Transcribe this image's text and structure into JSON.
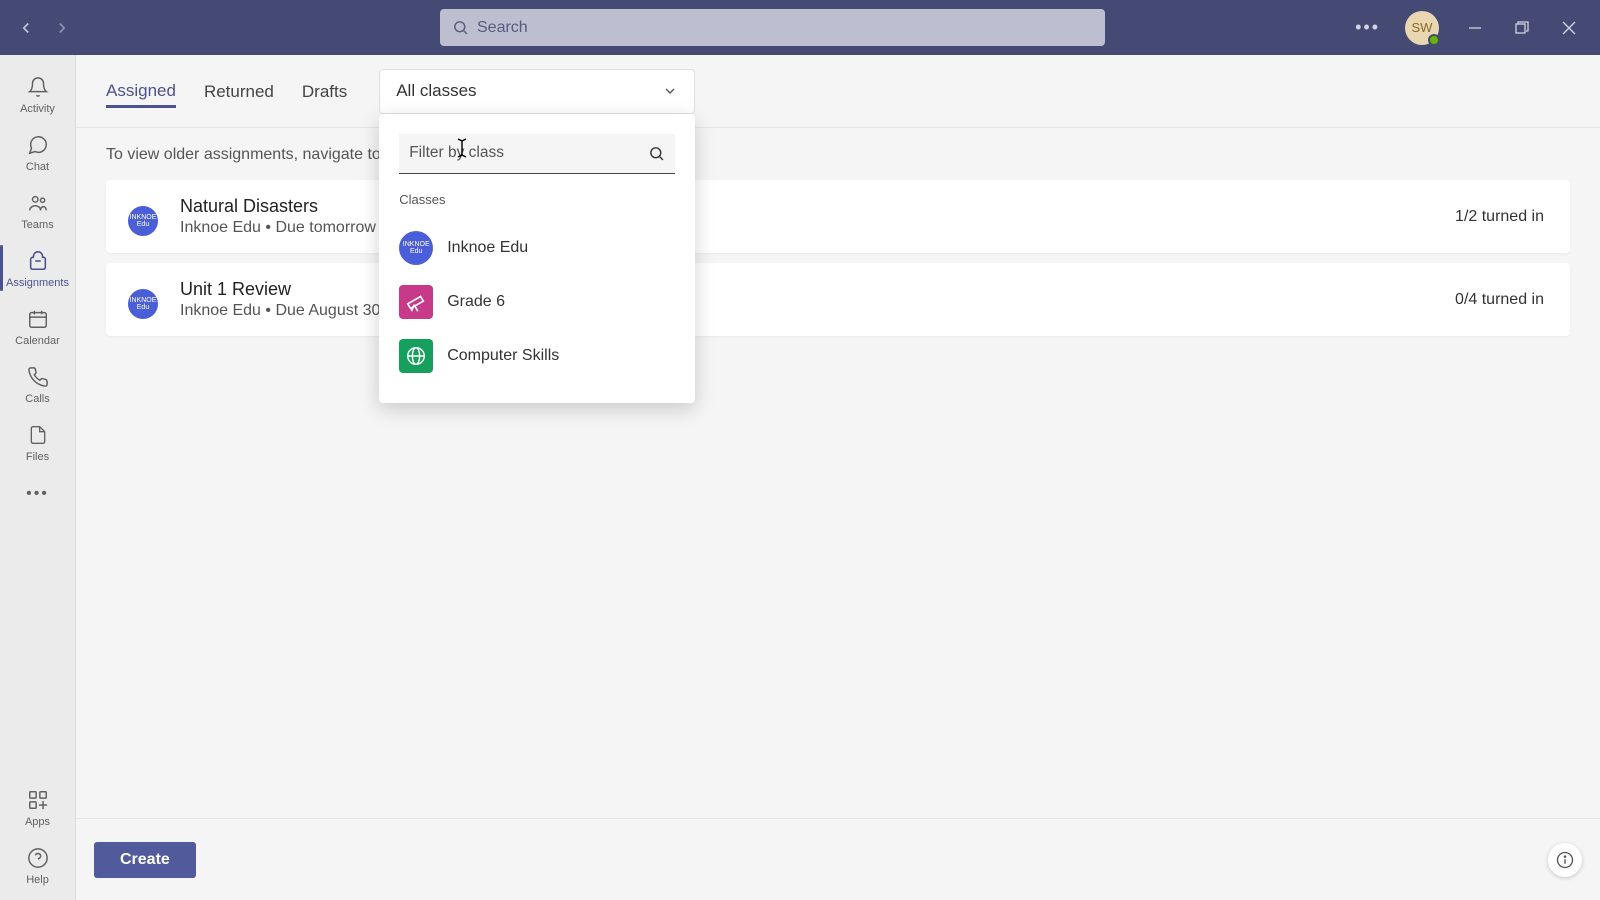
{
  "titlebar": {
    "search_placeholder": "Search",
    "avatar_initials": "SW"
  },
  "rail": {
    "items": [
      {
        "key": "activity",
        "label": "Activity"
      },
      {
        "key": "chat",
        "label": "Chat"
      },
      {
        "key": "teams",
        "label": "Teams"
      },
      {
        "key": "assignments",
        "label": "Assignments"
      },
      {
        "key": "calendar",
        "label": "Calendar"
      },
      {
        "key": "calls",
        "label": "Calls"
      },
      {
        "key": "files",
        "label": "Files"
      }
    ],
    "apps_label": "Apps",
    "help_label": "Help"
  },
  "tabs": {
    "assigned": "Assigned",
    "returned": "Returned",
    "drafts": "Drafts"
  },
  "class_selector": {
    "selected": "All classes"
  },
  "dropdown": {
    "filter_placeholder": "Filter by class",
    "heading": "Classes",
    "items": [
      {
        "label": "Inknoe Edu",
        "icon": "ink"
      },
      {
        "label": "Grade 6",
        "icon": "grade"
      },
      {
        "label": "Computer Skills",
        "icon": "comp"
      }
    ]
  },
  "body": {
    "info_line": "To view older assignments, navigate to an individual class team.",
    "cards": [
      {
        "title": "Natural Disasters",
        "sub": "Inknoe Edu • Due tomorrow at 11:59 PM",
        "right": "1/2 turned in"
      },
      {
        "title": "Unit 1 Review",
        "sub": "Inknoe Edu • Due August 30, 2021 11:59 PM",
        "right": "0/4 turned in"
      }
    ]
  },
  "footer": {
    "create": "Create"
  }
}
